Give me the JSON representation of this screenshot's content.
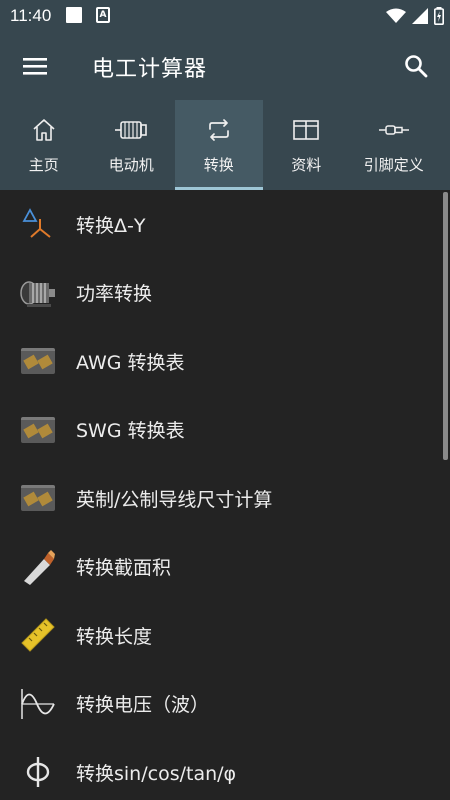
{
  "status_bar": {
    "time": "11:40",
    "notif_letter": "A"
  },
  "app_bar": {
    "title": "电工计算器"
  },
  "tabs": [
    {
      "label": "主页",
      "icon": "home-icon"
    },
    {
      "label": "电动机",
      "icon": "motor-icon"
    },
    {
      "label": "转换",
      "icon": "convert-icon",
      "active": true
    },
    {
      "label": "资料",
      "icon": "table-icon"
    },
    {
      "label": "引脚定义",
      "icon": "connector-icon"
    }
  ],
  "list_items": [
    {
      "label": "转换Δ-Y",
      "icon": "delta-wye-icon"
    },
    {
      "label": "功率转换",
      "icon": "motor-image-icon"
    },
    {
      "label": "AWG 转换表",
      "icon": "awg-chip-icon"
    },
    {
      "label": "SWG 转换表",
      "icon": "swg-chip-icon"
    },
    {
      "label": "英制/公制导线尺寸计算",
      "icon": "wire-size-chip-icon"
    },
    {
      "label": "转换截面积",
      "icon": "cable-icon"
    },
    {
      "label": "转换长度",
      "icon": "ruler-icon"
    },
    {
      "label": "转换电压（波）",
      "icon": "sine-wave-icon"
    },
    {
      "label": "转换sin/cos/tan/φ",
      "icon": "phi-icon"
    }
  ],
  "colors": {
    "header": "#37474f",
    "active_tab": "#455a64",
    "tab_indicator": "#9ec6d6",
    "background": "#232323"
  }
}
